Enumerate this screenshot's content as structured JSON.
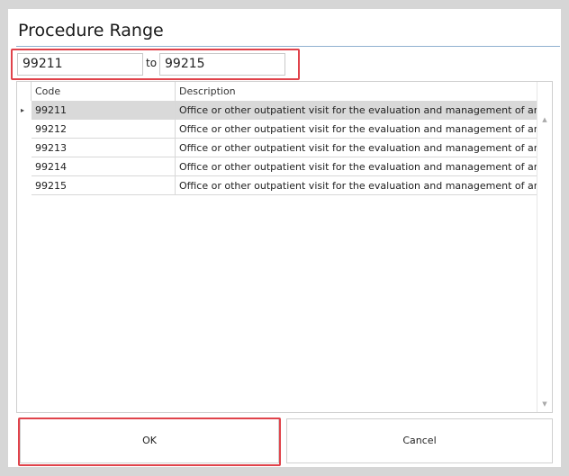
{
  "dialog": {
    "title": "Procedure Range"
  },
  "range": {
    "from_value": "99211",
    "to_label": "to",
    "to_value": "99215"
  },
  "grid": {
    "columns": [
      "Code",
      "Description"
    ],
    "rows": [
      {
        "code": "99211",
        "description": "Office or other outpatient visit for the evaluation and management of an..."
      },
      {
        "code": "99212",
        "description": "Office or other outpatient visit for the evaluation and management of an..."
      },
      {
        "code": "99213",
        "description": "Office or other outpatient visit for the evaluation and management of an..."
      },
      {
        "code": "99214",
        "description": "Office or other outpatient visit for the evaluation and management of an..."
      },
      {
        "code": "99215",
        "description": "Office or other outpatient visit for the evaluation and management of an..."
      }
    ],
    "selected_row": 0,
    "current_row_indicator": "▸"
  },
  "buttons": {
    "ok_label": "OK",
    "cancel_label": "Cancel"
  },
  "colors": {
    "highlight": "#e0434b",
    "selected_row": "#d9d9d9",
    "title_rule": "#8fb0cf"
  }
}
